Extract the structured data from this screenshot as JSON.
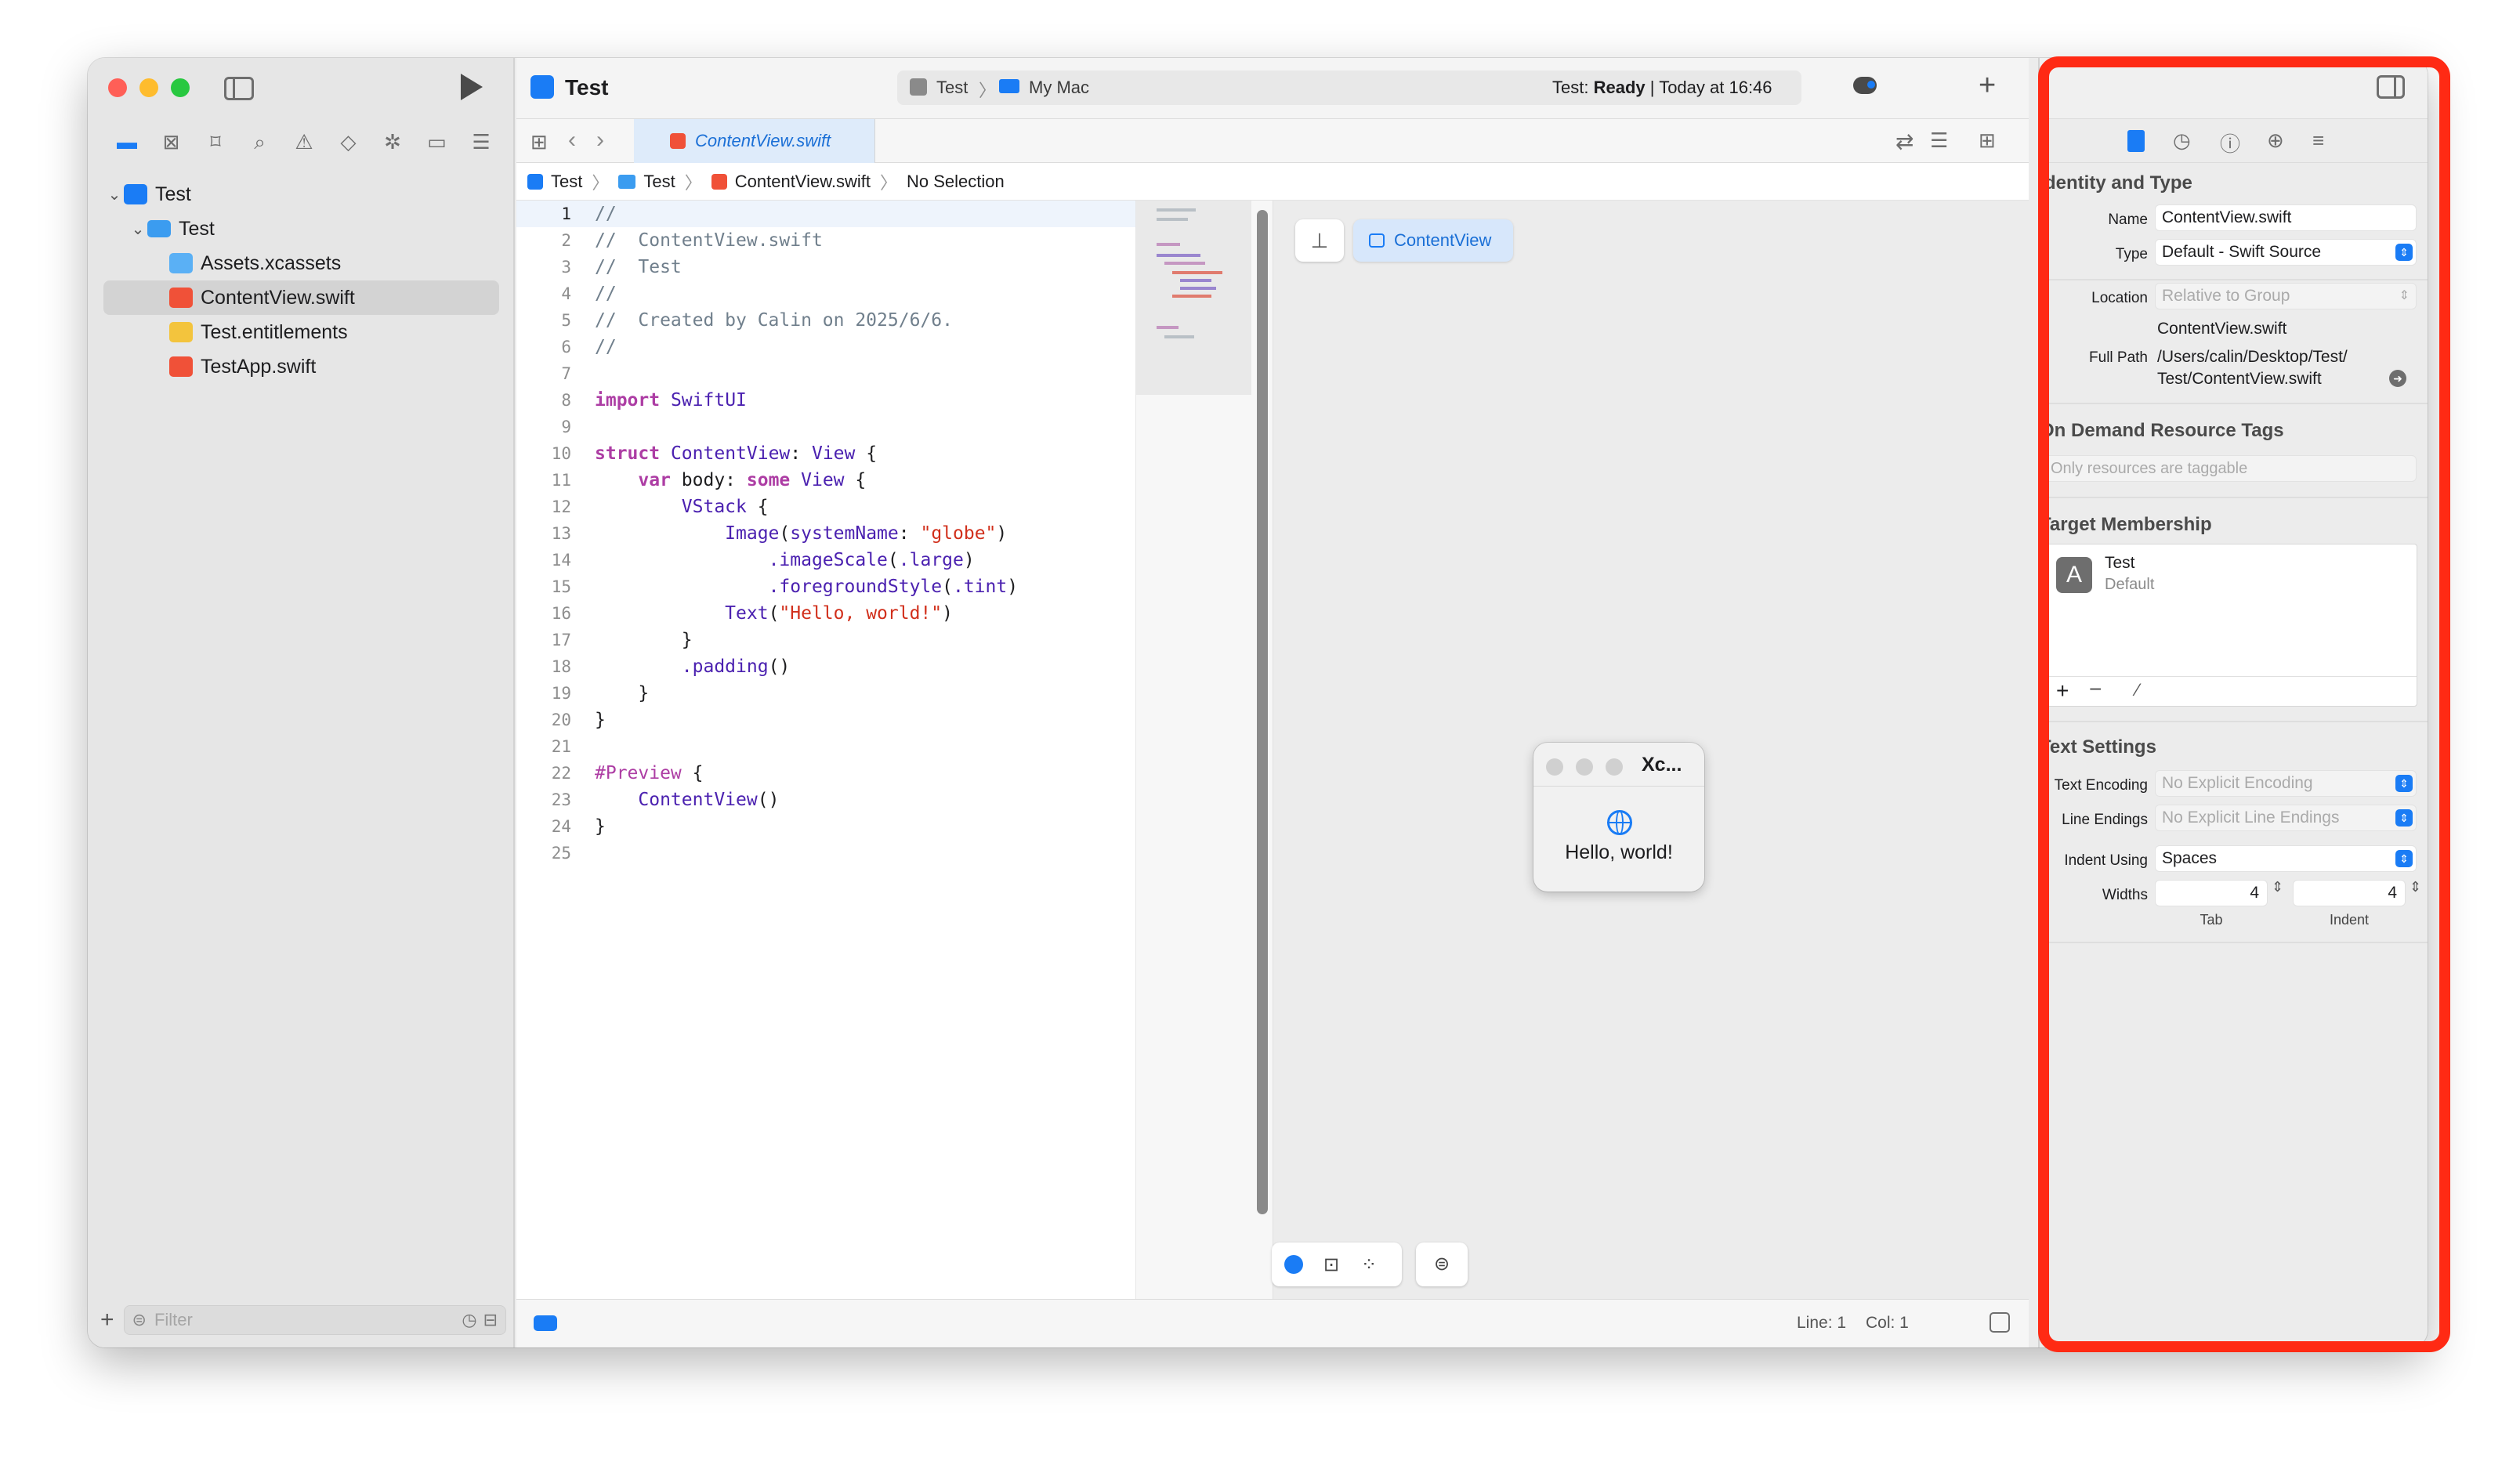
{
  "toolbar": {
    "project_title": "Test",
    "scheme": "Test",
    "destination": "My Mac",
    "status_prefix": "Test:",
    "status_state": "Ready",
    "status_time": "| Today at 16:46"
  },
  "tab": {
    "label": "ContentView.swift"
  },
  "jumpbar": {
    "items": [
      "Test",
      "Test",
      "ContentView.swift",
      "No Selection"
    ]
  },
  "navigator": {
    "items": [
      {
        "label": "Test"
      },
      {
        "label": "Test"
      },
      {
        "label": "Assets.xcassets"
      },
      {
        "label": "ContentView.swift"
      },
      {
        "label": "Test.entitlements"
      },
      {
        "label": "TestApp.swift"
      }
    ],
    "filter_placeholder": "Filter"
  },
  "code_lines": [
    "//",
    "//  ContentView.swift",
    "//  Test",
    "//",
    "//  Created by Calin on 2025/6/6.",
    "//",
    "",
    "import SwiftUI",
    "",
    "struct ContentView: View {",
    "    var body: some View {",
    "        VStack {",
    "            Image(systemName: \"globe\")",
    "                .imageScale(.large)",
    "                .foregroundStyle(.tint)",
    "            Text(\"Hello, world!\")",
    "        }",
    "        .padding()",
    "    }",
    "}",
    "",
    "#Preview {",
    "    ContentView()",
    "}",
    ""
  ],
  "line_numbers": [
    "1",
    "2",
    "3",
    "4",
    "5",
    "6",
    "7",
    "8",
    "9",
    "10",
    "11",
    "12",
    "13",
    "14",
    "15",
    "16",
    "17",
    "18",
    "19",
    "20",
    "21",
    "22",
    "23",
    "24",
    "25"
  ],
  "preview": {
    "selector_label": "ContentView",
    "window_title": "Xc...",
    "hello_text": "Hello, world!"
  },
  "statusbar": {
    "line": "Line: 1",
    "col": "Col: 1"
  },
  "inspector": {
    "identity_title": "dentity and Type",
    "name_label": "Name",
    "name_value": "ContentView.swift",
    "type_label": "Type",
    "type_value": "Default - Swift Source",
    "location_label": "Location",
    "location_value": "Relative to Group",
    "location_file": "ContentView.swift",
    "fullpath_label": "Full Path",
    "fullpath_line1": "/Users/calin/Desktop/Test/",
    "fullpath_line2": "Test/ContentView.swift",
    "ondemand_title": "On Demand Resource Tags",
    "ondemand_placeholder": "Only resources are taggable",
    "target_title": "Target Membership",
    "target_name": "Test",
    "target_sub": "Default",
    "text_title": "Text Settings",
    "encoding_label": "Text Encoding",
    "encoding_value": "No Explicit Encoding",
    "endings_label": "Line Endings",
    "endings_value": "No Explicit Line Endings",
    "indent_label": "Indent Using",
    "indent_value": "Spaces",
    "widths_label": "Widths",
    "tab_value": "4",
    "indent_value_num": "4",
    "tab_caption": "Tab",
    "indent_caption": "Indent"
  },
  "colors": {
    "accent": "#1a7cf5",
    "highlight_border": "#ff2a14",
    "keyword": "#ad3da4",
    "type": "#4b21b0",
    "string": "#d12f1b",
    "comment": "#707f8c"
  }
}
